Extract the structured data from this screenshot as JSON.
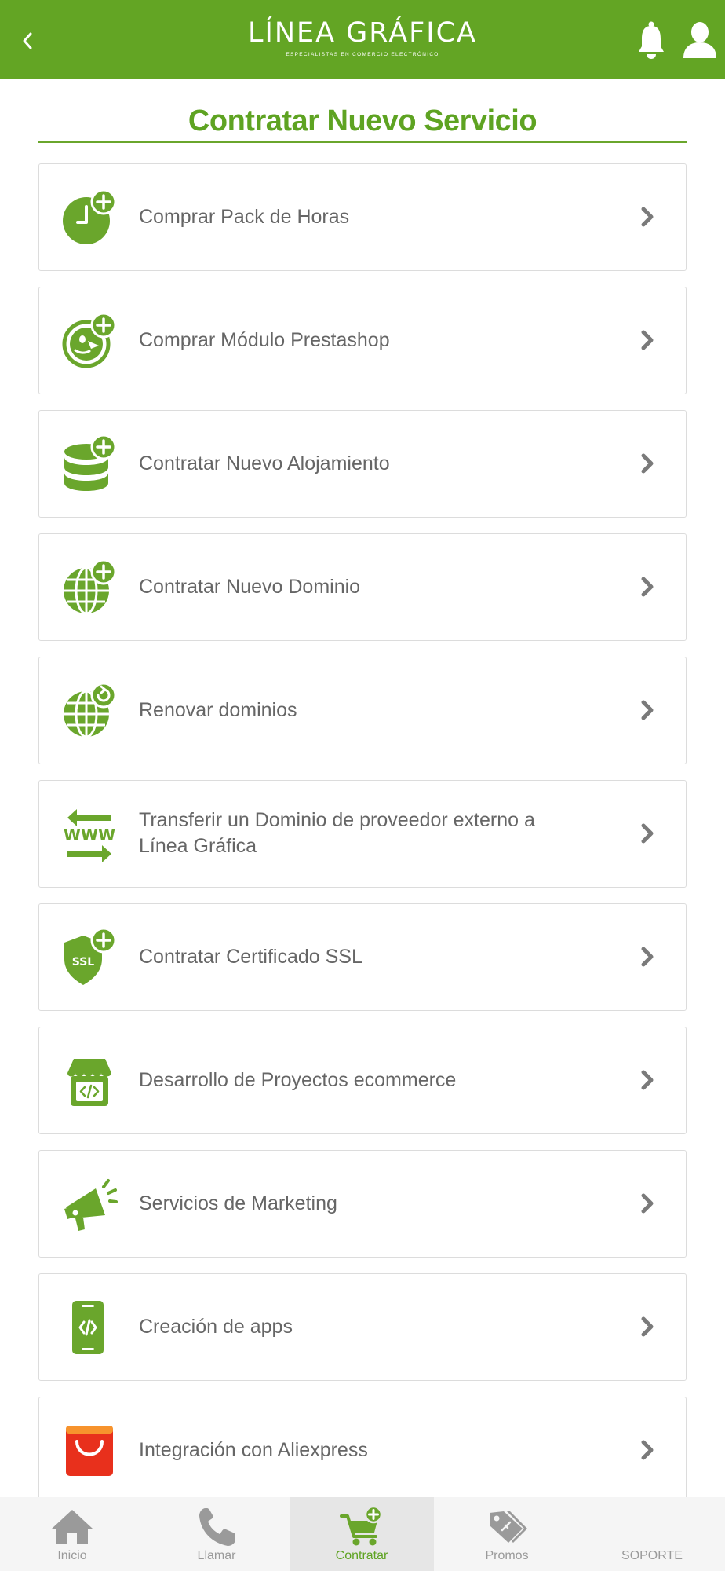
{
  "header": {
    "logo_name": "LÍNEA GRÁFICA",
    "logo_tagline": "ESPECIALISTAS EN COMERCIO ELECTRÓNICO",
    "icons": {
      "back": "chevron-left-icon",
      "notifications": "bell-icon",
      "profile": "user-icon"
    }
  },
  "page": {
    "title": "Contratar Nuevo Servicio"
  },
  "services": [
    {
      "label": "Comprar Pack de Horas",
      "icon": "clock-plus-icon"
    },
    {
      "label": "Comprar Módulo Prestashop",
      "icon": "prestashop-plus-icon"
    },
    {
      "label": "Contratar Nuevo Alojamiento",
      "icon": "database-plus-icon"
    },
    {
      "label": "Contratar Nuevo Dominio",
      "icon": "globe-plus-icon"
    },
    {
      "label": "Renovar dominios",
      "icon": "globe-refresh-icon"
    },
    {
      "label": "Transferir un Dominio de proveedor externo a Línea Gráfica",
      "icon": "www-transfer-icon"
    },
    {
      "label": "Contratar Certificado SSL",
      "icon": "ssl-shield-plus-icon"
    },
    {
      "label": "Desarrollo de Proyectos ecommerce",
      "icon": "store-code-icon"
    },
    {
      "label": "Servicios de Marketing",
      "icon": "megaphone-icon"
    },
    {
      "label": "Creación de apps",
      "icon": "smartphone-code-icon"
    },
    {
      "label": "Integración con Aliexpress",
      "icon": "aliexpress-bag-icon"
    }
  ],
  "tabs": [
    {
      "label": "Inicio",
      "icon": "home-icon",
      "active": false
    },
    {
      "label": "Llamar",
      "icon": "phone-icon",
      "active": false
    },
    {
      "label": "Contratar",
      "icon": "cart-plus-icon",
      "active": true
    },
    {
      "label": "Promos",
      "icon": "tags-icon",
      "active": false
    },
    {
      "label": "SOPORTE",
      "icon": "",
      "active": false
    }
  ],
  "colors": {
    "brand_green": "#63a524",
    "title_green": "#5ea322",
    "icon_green": "#6aa62c",
    "text_gray": "#666666",
    "chevron_gray": "#7a7a7a",
    "tab_gray": "#9a9a9a",
    "aliexpress_red": "#e8301c",
    "aliexpress_orange": "#f7932d"
  }
}
